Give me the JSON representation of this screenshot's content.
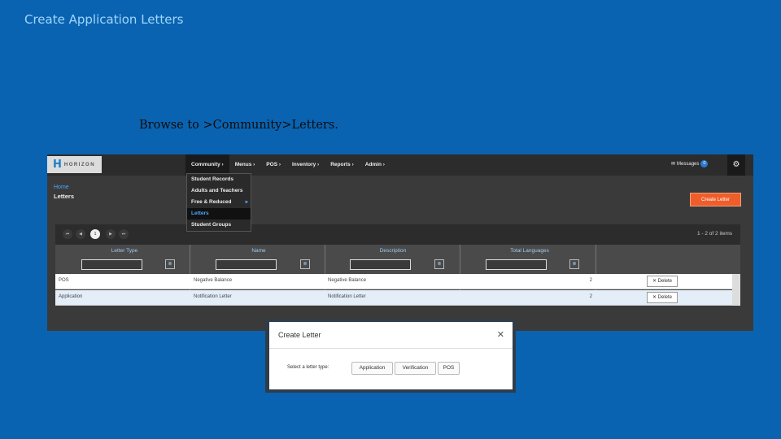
{
  "slide": {
    "title": "Create Application Letters",
    "caption": "Browse to >Community>Letters."
  },
  "app": {
    "logo": {
      "letter": "H",
      "text": "HORIZON"
    },
    "nav": [
      "Community ›",
      "Menus ›",
      "POS ›",
      "Inventory ›",
      "Reports ›",
      "Admin ›"
    ],
    "messages": {
      "label": "Messages",
      "count": "0"
    },
    "gear_icon": "gear-icon",
    "dropdown": [
      {
        "label": "Student Records",
        "selected": false
      },
      {
        "label": "Adults and Teachers",
        "selected": false
      },
      {
        "label": "Free & Reduced",
        "selected": false,
        "has_sub": true
      },
      {
        "label": "Letters",
        "selected": true
      },
      {
        "label": "Student Groups",
        "selected": false
      }
    ],
    "breadcrumb": {
      "home": "Home",
      "page": "Letters"
    },
    "create_button": "Create Letter",
    "pager": {
      "first": "⏮",
      "prev": "◀",
      "current": "1",
      "next": "▶",
      "last": "⏭",
      "items": "1 - 2 of 2 items"
    },
    "columns": [
      "Letter Type",
      "Name",
      "Description",
      "Total Languages"
    ],
    "rows": [
      {
        "type": "POS",
        "name": "Negative Balance",
        "description": "Negative Balance",
        "languages": "2",
        "action": "✕ Delete"
      },
      {
        "type": "Application",
        "name": "Notification Letter",
        "description": "Notification Letter",
        "languages": "2",
        "action": "✕ Delete"
      }
    ]
  },
  "modal": {
    "title": "Create Letter",
    "close": "✕",
    "prompt": "Select a letter type:",
    "options": [
      "Application",
      "Verification",
      "POS"
    ]
  }
}
